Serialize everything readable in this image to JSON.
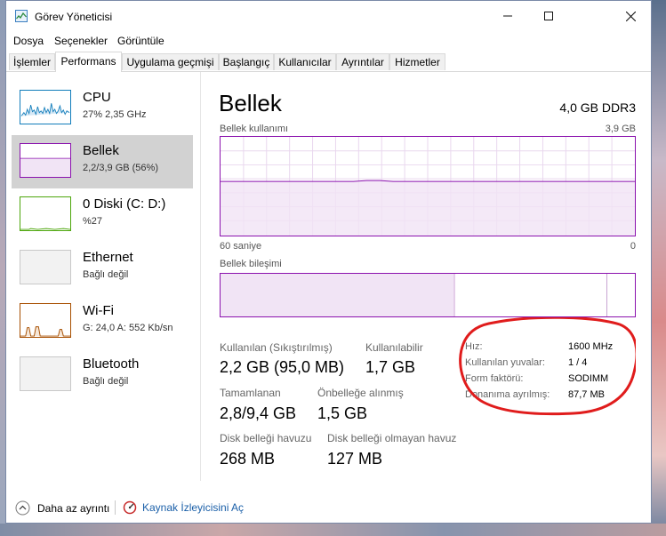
{
  "window": {
    "title": "Görev Yöneticisi"
  },
  "menu": {
    "items": [
      "Dosya",
      "Seçenekler",
      "Görüntüle"
    ]
  },
  "tabs": [
    "İşlemler",
    "Performans",
    "Uygulama geçmişi",
    "Başlangıç",
    "Kullanıcılar",
    "Ayrıntılar",
    "Hizmetler"
  ],
  "resources": [
    {
      "name": "CPU",
      "sub": "27%  2,35 GHz",
      "color": "#117dbb"
    },
    {
      "name": "Bellek",
      "sub": "2,2/3,9 GB (56%)",
      "color": "#8b12ae"
    },
    {
      "name": "0 Diski (C: D:)",
      "sub": "%27",
      "color": "#4da60c"
    },
    {
      "name": "Ethernet",
      "sub": "Bağlı değil",
      "color": "#a74f01"
    },
    {
      "name": "Wi-Fi",
      "sub": "G: 24,0  A: 552 Kb/sn",
      "color": "#a74f01"
    },
    {
      "name": "Bluetooth",
      "sub": "Bağlı değil",
      "color": "#a74f01"
    }
  ],
  "main": {
    "title": "Bellek",
    "spec": "4,0 GB DDR3",
    "usage_label": "Bellek kullanımı",
    "usage_max": "3,9 GB",
    "time_label": "60 saniye",
    "time_end": "0",
    "composition_label": "Bellek bileşimi",
    "usage_fraction": 0.56
  },
  "stats": {
    "in_use_label": "Kullanılan (Sıkıştırılmış)",
    "in_use_value": "2,2 GB (95,0 MB)",
    "available_label": "Kullanılabilir",
    "available_value": "1,7 GB",
    "committed_label": "Tamamlanan",
    "committed_value": "2,8/9,4 GB",
    "cached_label": "Önbelleğe alınmış",
    "cached_value": "1,5 GB",
    "paged_label": "Disk belleği havuzu",
    "paged_value": "268 MB",
    "nonpaged_label": "Disk belleği olmayan havuz",
    "nonpaged_value": "127 MB"
  },
  "details": {
    "speed_label": "Hız:",
    "speed_value": "1600 MHz",
    "slots_label": "Kullanılan yuvalar:",
    "slots_value": "1 / 4",
    "form_label": "Form faktörü:",
    "form_value": "SODIMM",
    "reserved_label": "Donanıma ayrılmış:",
    "reserved_value": "87,7 MB"
  },
  "footer": {
    "fewer_details": "Daha az ayrıntı",
    "resource_monitor": "Kaynak İzleyicisini Aç"
  }
}
